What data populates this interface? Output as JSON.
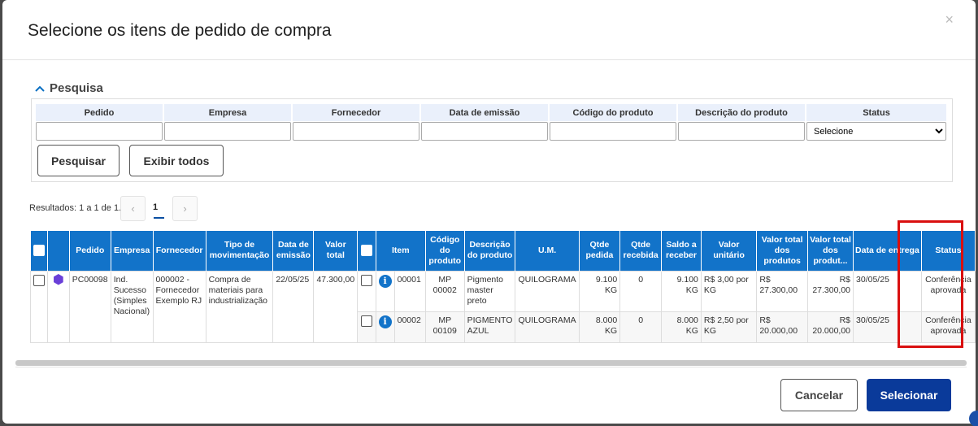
{
  "dialog": {
    "title": "Selecione os itens de pedido de compra",
    "close_icon": "×"
  },
  "search": {
    "section_title": "Pesquisa",
    "chevron_icon": "chevron-up-icon",
    "labels": [
      "Pedido",
      "Empresa",
      "Fornecedor",
      "Data de emissão",
      "Código do produto",
      "Descrição do produto",
      "Status"
    ],
    "status_select_value": "Selecione",
    "search_button": "Pesquisar",
    "show_all_button": "Exibir todos"
  },
  "pagination": {
    "results_text": "Resultados: 1 a 1 de 1.",
    "prev": "‹",
    "current": "1",
    "next": "›"
  },
  "table": {
    "headers": {
      "pedido": "Pedido",
      "empresa": "Empresa",
      "fornecedor": "Fornecedor",
      "tipo": "Tipo de movimentação",
      "data_emissao": "Data de emissão",
      "valor_total": "Valor total",
      "item": "Item",
      "codigo": "Código do produto",
      "descricao": "Descrição do produto",
      "um": "U.M.",
      "qtde_pedida": "Qtde pedida",
      "qtde_recebida": "Qtde recebida",
      "saldo": "Saldo a receber",
      "valor_unitario": "Valor unitário",
      "valor_total_produtos": "Valor total dos produtos",
      "valor_total_produt": "Valor total dos produt...",
      "data_entrega": "Data de entrega",
      "status": "Status"
    },
    "order": {
      "pedido": "PC00098",
      "empresa": "Ind. Sucesso (Simples Nacional)",
      "fornecedor": "000002 - Fornecedor Exemplo RJ",
      "tipo": "Compra de materiais para industrialização",
      "data_emissao": "22/05/25",
      "valor_total": "47.300,00"
    },
    "items": [
      {
        "item": "00001",
        "codigo": "MP 00002",
        "descricao": "Pigmento master preto",
        "um": "QUILOGRAMA",
        "qtde_pedida": "9.100 KG",
        "qtde_recebida": "0",
        "saldo": "9.100 KG",
        "valor_unitario": "R$ 3,00 por KG",
        "valor_total_produtos": "R$ 27.300,00",
        "valor_total_produt": "R$ 27.300,00",
        "data_entrega": "30/05/25",
        "status": "Conferência aprovada"
      },
      {
        "item": "00002",
        "codigo": "MP 00109",
        "descricao": "PIGMENTO AZUL",
        "um": "QUILOGRAMA",
        "qtde_pedida": "8.000 KG",
        "qtde_recebida": "0",
        "saldo": "8.000 KG",
        "valor_unitario": "R$ 2,50 por KG",
        "valor_total_produtos": "R$ 20.000,00",
        "valor_total_produt": "R$ 20.000,00",
        "data_entrega": "30/05/25",
        "status": "Conferência aprovada"
      }
    ]
  },
  "footer": {
    "cancel_button": "Cancelar",
    "select_button": "Selecionar"
  },
  "colors": {
    "header_blue": "#1273c9",
    "primary_button": "#0a3a9a",
    "highlight_red": "#d90f0f",
    "order_icon_purple": "#6a3fd8"
  }
}
